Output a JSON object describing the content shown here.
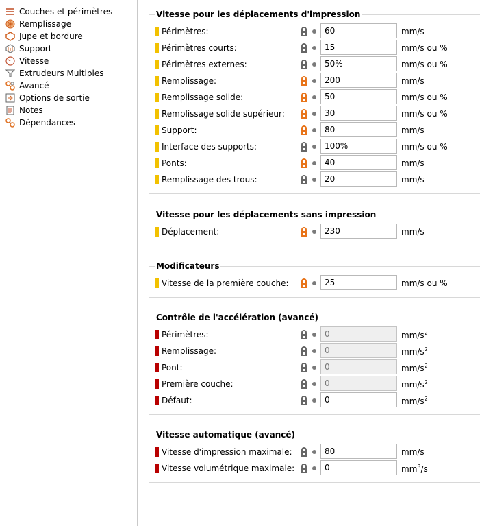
{
  "sidebar": {
    "items": [
      {
        "label": "Couches et périmètres",
        "icon": "layers-icon"
      },
      {
        "label": "Remplissage",
        "icon": "infill-icon"
      },
      {
        "label": "Jupe et bordure",
        "icon": "skirt-icon"
      },
      {
        "label": "Support",
        "icon": "support-icon"
      },
      {
        "label": "Vitesse",
        "icon": "speed-icon",
        "selected": true
      },
      {
        "label": "Extrudeurs Multiples",
        "icon": "funnel-icon"
      },
      {
        "label": "Avancé",
        "icon": "wrench-icon"
      },
      {
        "label": "Options de sortie",
        "icon": "output-icon"
      },
      {
        "label": "Notes",
        "icon": "notes-icon"
      },
      {
        "label": "Dépendances",
        "icon": "dependencies-icon"
      }
    ]
  },
  "groups": {
    "print_moves": {
      "title": "Vitesse pour les déplacements d'impression",
      "rows": [
        {
          "label": "Périmètres:",
          "value": "60",
          "unit": "mm/s",
          "lock": "gray",
          "marker": "yellow"
        },
        {
          "label": "Périmètres courts:",
          "value": "15",
          "unit": "mm/s ou %",
          "lock": "gray",
          "marker": "yellow"
        },
        {
          "label": "Périmètres externes:",
          "value": "50%",
          "unit": "mm/s ou %",
          "lock": "gray",
          "marker": "yellow"
        },
        {
          "label": "Remplissage:",
          "value": "200",
          "unit": "mm/s",
          "lock": "orange",
          "marker": "yellow"
        },
        {
          "label": "Remplissage solide:",
          "value": "50",
          "unit": "mm/s ou %",
          "lock": "orange",
          "marker": "yellow"
        },
        {
          "label": "Remplissage solide supérieur:",
          "value": "30",
          "unit": "mm/s ou %",
          "lock": "orange",
          "marker": "yellow"
        },
        {
          "label": "Support:",
          "value": "80",
          "unit": "mm/s",
          "lock": "orange",
          "marker": "yellow"
        },
        {
          "label": "Interface des supports:",
          "value": "100%",
          "unit": "mm/s ou %",
          "lock": "gray",
          "marker": "yellow"
        },
        {
          "label": "Ponts:",
          "value": "40",
          "unit": "mm/s",
          "lock": "orange",
          "marker": "yellow"
        },
        {
          "label": "Remplissage des trous:",
          "value": "20",
          "unit": "mm/s",
          "lock": "gray",
          "marker": "yellow"
        }
      ]
    },
    "travel": {
      "title": "Vitesse pour les déplacements sans impression",
      "rows": [
        {
          "label": "Déplacement:",
          "value": "230",
          "unit": "mm/s",
          "lock": "orange",
          "marker": "yellow"
        }
      ]
    },
    "modifiers": {
      "title": "Modificateurs",
      "rows": [
        {
          "label": "Vitesse de la première couche:",
          "value": "25",
          "unit": "mm/s ou %",
          "lock": "orange",
          "marker": "yellow"
        }
      ]
    },
    "acceleration": {
      "title": "Contrôle de l'accélération (avancé)",
      "rows": [
        {
          "label": "Périmètres:",
          "value": "0",
          "unit": "mm/s",
          "unit_sup": "2",
          "lock": "gray",
          "marker": "red",
          "disabled": true
        },
        {
          "label": "Remplissage:",
          "value": "0",
          "unit": "mm/s",
          "unit_sup": "2",
          "lock": "gray",
          "marker": "red",
          "disabled": true
        },
        {
          "label": "Pont:",
          "value": "0",
          "unit": "mm/s",
          "unit_sup": "2",
          "lock": "gray",
          "marker": "red",
          "disabled": true
        },
        {
          "label": "Première couche:",
          "value": "0",
          "unit": "mm/s",
          "unit_sup": "2",
          "lock": "gray",
          "marker": "red",
          "disabled": true
        },
        {
          "label": "Défaut:",
          "value": "0",
          "unit": "mm/s",
          "unit_sup": "2",
          "lock": "gray",
          "marker": "red"
        }
      ]
    },
    "autospeed": {
      "title": "Vitesse automatique (avancé)",
      "rows": [
        {
          "label": "Vitesse d'impression maximale:",
          "value": "80",
          "unit": "mm/s",
          "lock": "gray",
          "marker": "red"
        },
        {
          "label": "Vitesse volumétrique maximale:",
          "value": "0",
          "unit": "mm",
          "unit_sup": "3",
          "unit_after": "/s",
          "lock": "gray",
          "marker": "red"
        }
      ]
    }
  },
  "colors": {
    "marker_yellow": "#f2c100",
    "marker_red": "#b80000",
    "lock_gray": "#666666",
    "lock_orange": "#e8741a"
  }
}
